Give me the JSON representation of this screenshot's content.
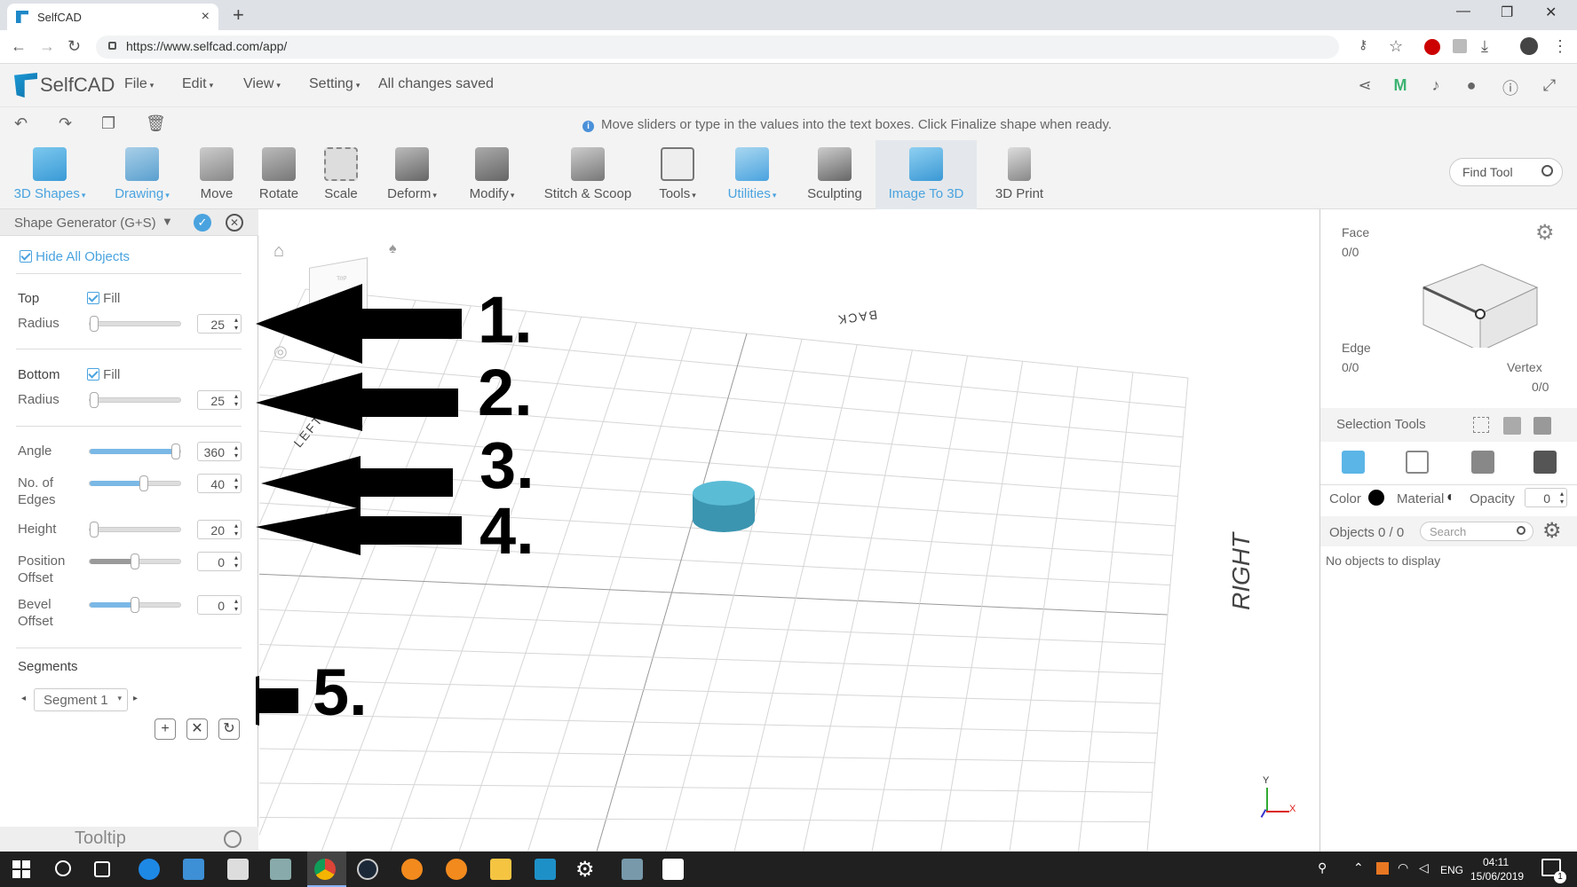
{
  "browser": {
    "tab_title": "SelfCAD",
    "tab_close": "×",
    "new_tab": "+",
    "url": "https://www.selfcad.com/app/",
    "min": "—",
    "restore": "❐",
    "close": "✕"
  },
  "app": {
    "logo_text": "SelfCAD",
    "menus": [
      "File",
      "Edit",
      "View",
      "Setting"
    ],
    "save_status": "All changes saved",
    "hint": "Move sliders or type in the values into the text boxes. Click Finalize shape when ready."
  },
  "toolbar": {
    "tools": [
      {
        "label": "3D Shapes",
        "dropdown": true
      },
      {
        "label": "Drawing",
        "dropdown": true
      },
      {
        "label": "Move",
        "dropdown": false
      },
      {
        "label": "Rotate",
        "dropdown": false
      },
      {
        "label": "Scale",
        "dropdown": false
      },
      {
        "label": "Deform",
        "dropdown": true
      },
      {
        "label": "Modify",
        "dropdown": true
      },
      {
        "label": "Stitch & Scoop",
        "dropdown": false
      },
      {
        "label": "Tools",
        "dropdown": true
      },
      {
        "label": "Utilities",
        "dropdown": true
      },
      {
        "label": "Sculpting",
        "dropdown": false
      },
      {
        "label": "Image To 3D",
        "dropdown": false
      },
      {
        "label": "3D Print",
        "dropdown": false
      }
    ],
    "find_tool": "Find Tool"
  },
  "panel": {
    "title": "Shape Generator (G+S)",
    "hide_all": "Hide All Objects",
    "top_label": "Top",
    "bottom_label": "Bottom",
    "fill_label": "Fill",
    "radius_label": "Radius",
    "top_radius": "25",
    "bottom_radius": "25",
    "angle_label": "Angle",
    "angle": "360",
    "edges_label_1": "No. of",
    "edges_label_2": "Edges",
    "edges": "40",
    "height_label": "Height",
    "height": "20",
    "pos_label_1": "Position",
    "pos_label_2": "Offset",
    "pos": "0",
    "bevel_label_1": "Bevel",
    "bevel_label_2": "Offset",
    "bevel": "0",
    "segments_label": "Segments",
    "segment": "Segment 1",
    "tooltip": "Tooltip",
    "sliders": {
      "top_radius": 0.05,
      "bottom_radius": 0.05,
      "angle": 1.0,
      "edges": 0.6,
      "height": 0.0,
      "pos": 0.5,
      "bevel": 0.5
    }
  },
  "annotations": [
    "1.",
    "2.",
    "3.",
    "4.",
    "5."
  ],
  "viewport": {
    "back_label": "BACK",
    "left_label": "LEFT",
    "right_label": "RIGHT",
    "axis_y": "Y",
    "axis_x": "X",
    "cube_label": "Top",
    "object_color": "#5bbcd6"
  },
  "right_panel": {
    "face_label": "Face",
    "face_value": "0/0",
    "edge_label": "Edge",
    "edge_value": "0/0",
    "vertex_label": "Vertex",
    "vertex_value": "0/0",
    "selection_tools": "Selection Tools",
    "color_label": "Color",
    "material_label": "Material",
    "opacity_label": "Opacity",
    "opacity": "0",
    "objects_label": "Objects 0 / 0",
    "search_placeholder": "Search",
    "no_objects": "No objects to display"
  },
  "taskbar": {
    "lang": "ENG",
    "time": "04:11",
    "date": "15/06/2019",
    "notif_count": "1"
  },
  "colors": {
    "accent": "#4aa3df",
    "brand": "#1e88c8"
  }
}
